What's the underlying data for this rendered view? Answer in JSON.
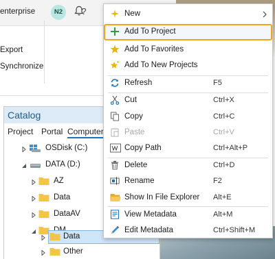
{
  "header": {
    "portal_text": "enterprise",
    "user_initials": "N2",
    "help_label": "?"
  },
  "ribbon": {
    "export_label": "Export",
    "synchronize_label": "Synchronize"
  },
  "catalog": {
    "title": "Catalog",
    "tabs": [
      "Project",
      "Portal",
      "Computer"
    ],
    "active_tab": "Computer",
    "tree": [
      {
        "label": "OSDisk (C:)",
        "icon": "drive-icon",
        "expanded": false
      },
      {
        "label": "DATA (D:)",
        "icon": "drive-icon",
        "expanded": true
      },
      {
        "label": "AZ",
        "icon": "folder-icon",
        "expanded": false
      },
      {
        "label": "Data",
        "icon": "folder-icon",
        "expanded": false
      },
      {
        "label": "DataAV",
        "icon": "folder-icon",
        "expanded": false
      },
      {
        "label": "DM",
        "icon": "folder-icon",
        "expanded": true
      },
      {
        "label": "Data",
        "icon": "folder-icon",
        "expanded": false,
        "selected": true
      },
      {
        "label": "Other",
        "icon": "folder-icon",
        "expanded": false
      }
    ]
  },
  "context_menu": {
    "items": [
      {
        "label": "New",
        "shortcut": "",
        "icon": "new-sparkle-icon",
        "submenu": true
      },
      {
        "label": "Add To Project",
        "shortcut": "",
        "icon": "plus-icon",
        "highlighted": true
      },
      {
        "label": "Add To Favorites",
        "shortcut": "",
        "icon": "star-icon"
      },
      {
        "label": "Add To New Projects",
        "shortcut": "",
        "icon": "star-sparkle-icon"
      },
      {
        "label": "Refresh",
        "shortcut": "F5",
        "icon": "refresh-icon"
      },
      {
        "label": "Cut",
        "shortcut": "Ctrl+X",
        "icon": "scissors-icon"
      },
      {
        "label": "Copy",
        "shortcut": "Ctrl+C",
        "icon": "copy-icon"
      },
      {
        "label": "Paste",
        "shortcut": "Ctrl+V",
        "icon": "paste-icon",
        "disabled": true
      },
      {
        "label": "Copy Path",
        "shortcut": "Ctrl+Alt+P",
        "icon": "copy-path-icon"
      },
      {
        "label": "Delete",
        "shortcut": "Ctrl+D",
        "icon": "delete-icon"
      },
      {
        "label": "Rename",
        "shortcut": "F2",
        "icon": "rename-icon"
      },
      {
        "label": "Show In File Explorer",
        "shortcut": "Alt+E",
        "icon": "folder-open-icon"
      },
      {
        "label": "View Metadata",
        "shortcut": "Alt+M",
        "icon": "metadata-icon"
      },
      {
        "label": "Edit Metadata",
        "shortcut": "Ctrl+Shift+M",
        "icon": "pencil-icon"
      }
    ]
  },
  "colors": {
    "highlight_border": "#f2a51b",
    "catalog_header_bg": "#dcebf7",
    "selection_bg": "#cfe5f8",
    "folder": "#f2c447",
    "accent_blue": "#1a73b6",
    "plus_green": "#2e9a3a",
    "star_gold": "#e8b514"
  }
}
